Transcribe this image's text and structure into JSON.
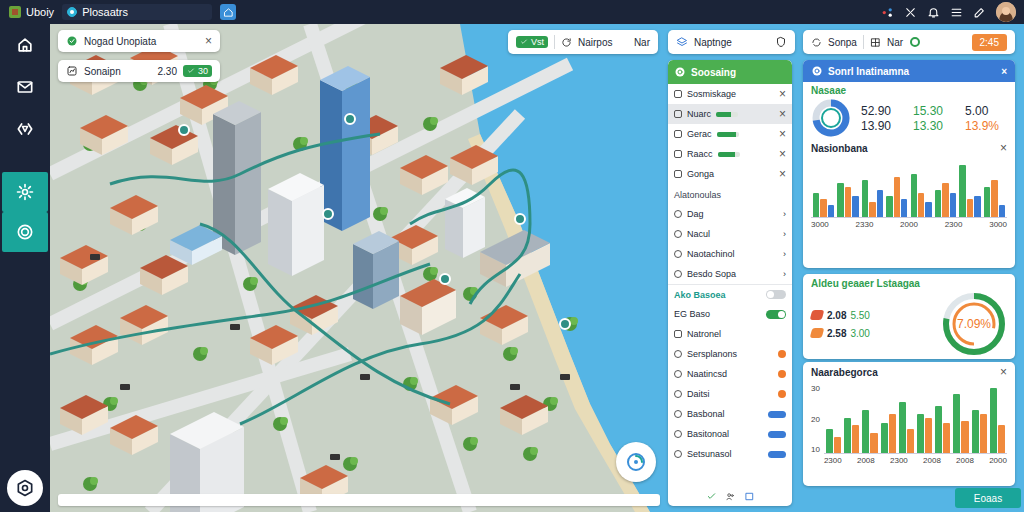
{
  "app": {
    "name": "Uboiy",
    "tab": "Plosaatrs"
  },
  "sidebar": {
    "items": [
      {
        "selected": false
      },
      {
        "selected": false
      },
      {
        "selected": false
      },
      {
        "selected": true
      },
      {
        "selected": true
      }
    ]
  },
  "search_card": {
    "title": "Nogad Unopiata",
    "close": "×"
  },
  "route_card": {
    "label": "Sonaipn",
    "value": "2.30",
    "badge": "30"
  },
  "toolbar": {
    "left": [
      "Vst",
      "Nairpos",
      "Nar"
    ],
    "middle": "Naptnge",
    "right": [
      "Sonpa",
      "Nar"
    ],
    "action": "2:45"
  },
  "layers": {
    "title": "Soosaing",
    "items": [
      {
        "label": "Sosmiskage",
        "close": "×",
        "kind": "plain",
        "selected": false
      },
      {
        "label": "Nuarc",
        "close": "×",
        "kind": "bar",
        "level": 0.7,
        "selected": true
      },
      {
        "label": "Gerac",
        "close": "×",
        "kind": "bar",
        "level": 0.9,
        "selected": false
      },
      {
        "label": "Raacc",
        "close": "×",
        "kind": "bar",
        "level": 0.8,
        "selected": false
      },
      {
        "label": "Gonga",
        "close": "×",
        "kind": "plain",
        "selected": false
      }
    ],
    "section": "Alatonoulas",
    "links": [
      {
        "label": "Dag",
        "arrow": "›"
      },
      {
        "label": "Nacul",
        "arrow": "›"
      },
      {
        "label": "Naotachinol",
        "arrow": "›"
      },
      {
        "label": "Besdo Sopa",
        "arrow": "›"
      }
    ],
    "group": {
      "title": "Ako Basoea",
      "on": false
    },
    "options": [
      {
        "label": "EG Baso",
        "kind": "toggle",
        "on": true
      },
      {
        "label": "Natronel",
        "kind": "plain"
      },
      {
        "label": "Sersplanons",
        "kind": "dot",
        "color": "#f07b2c"
      },
      {
        "label": "Naatincsd",
        "kind": "dot",
        "color": "#f07b2c"
      },
      {
        "label": "Daitsi",
        "kind": "dot",
        "color": "#f07b2c"
      },
      {
        "label": "Basbonal",
        "kind": "pill",
        "color": "#3a7bd5"
      },
      {
        "label": "Basitonoal",
        "kind": "pill",
        "color": "#3a7bd5"
      },
      {
        "label": "Setsunasol",
        "kind": "pill",
        "color": "#3a7bd5"
      }
    ]
  },
  "stats": {
    "title": "Sonrl Inatinamna",
    "close": "×",
    "subtitle": "Nasaae",
    "level": 0.72,
    "values": [
      {
        "text": "52.90",
        "color": "#1d2b3a"
      },
      {
        "text": "15.30",
        "color": "#2e9e4f"
      },
      {
        "text": "5.00",
        "color": "#1d2b3a"
      },
      {
        "text": "13.90",
        "color": "#1d2b3a"
      },
      {
        "text": "13.30",
        "color": "#2e9e4f"
      },
      {
        "text": "13.9%",
        "color": "#f07b2c"
      }
    ],
    "chart": {
      "title": "Nasionbana",
      "close": "×",
      "x_labels": [
        "3000",
        "2330",
        "2000",
        "2300",
        "3000"
      ],
      "max": 100,
      "series": [
        {
          "color": "#3cae5c",
          "values": [
            40,
            55,
            60,
            35,
            70,
            45,
            85,
            50
          ]
        },
        {
          "color": "#f08a3c",
          "values": [
            30,
            50,
            25,
            65,
            40,
            55,
            30,
            60
          ]
        },
        {
          "color": "#3a7bd5",
          "values": [
            20,
            35,
            45,
            30,
            25,
            40,
            35,
            20
          ]
        }
      ]
    }
  },
  "gauge": {
    "title": "Aldeu geaaer Lstaagaa",
    "reading": "7.09%",
    "level": 0.78,
    "items": [
      {
        "value": "2.08",
        "sub": "5.50",
        "color": "#e0593a"
      },
      {
        "value": "2.58",
        "sub": "3.00",
        "color": "#f08a3c"
      }
    ]
  },
  "trend": {
    "title": "Naarabegorca",
    "close": "×",
    "y_ticks": [
      "30",
      "20",
      "10"
    ],
    "x_labels": [
      "2300",
      "2008",
      "2300",
      "2008",
      "2008",
      "2000"
    ],
    "max": 35,
    "series": [
      {
        "color": "#3cae5c",
        "values": [
          12,
          18,
          22,
          15,
          26,
          20,
          24,
          30,
          22,
          33
        ]
      },
      {
        "color": "#f08a3c",
        "values": [
          8,
          14,
          10,
          20,
          12,
          18,
          15,
          16,
          20,
          14
        ]
      }
    ]
  },
  "button": "Eoaas"
}
